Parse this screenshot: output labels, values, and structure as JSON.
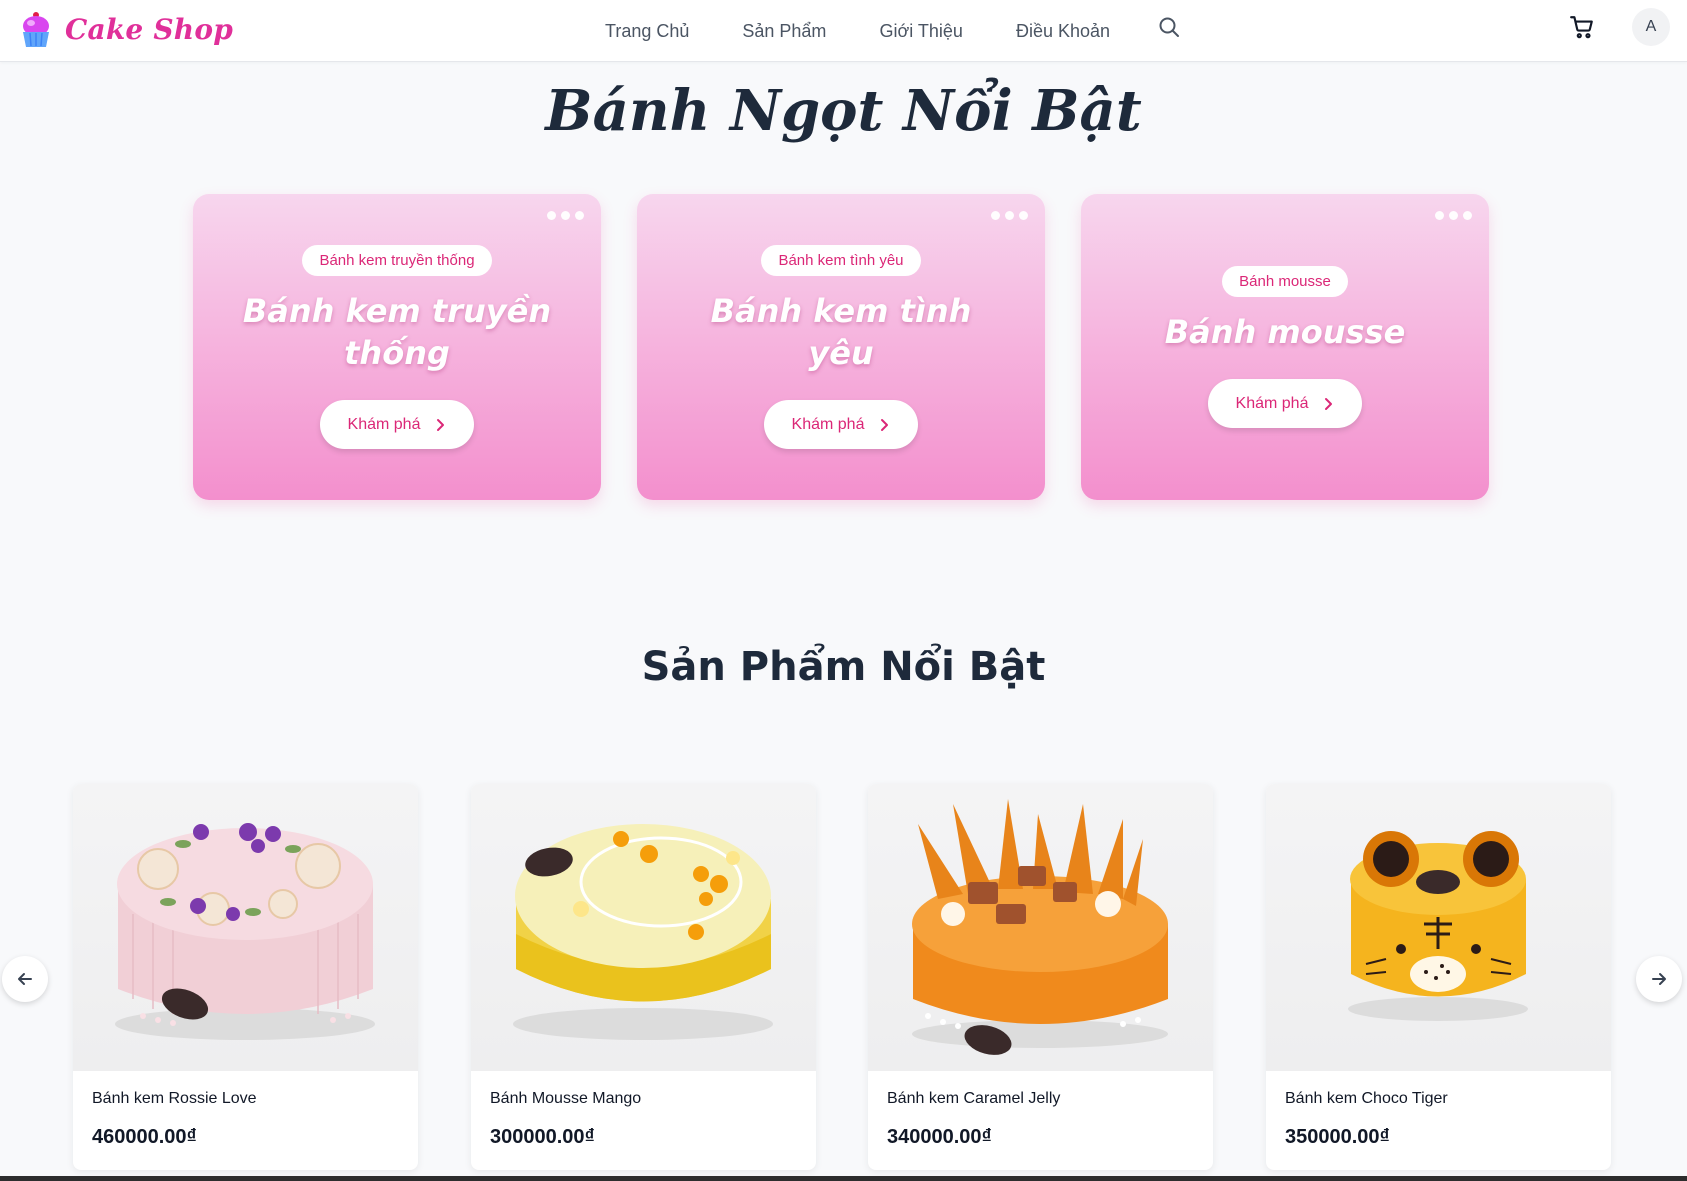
{
  "header": {
    "brand": "Cake Shop",
    "nav": [
      "Trang Chủ",
      "Sản Phẩm",
      "Giới Thiệu",
      "Điều Khoản"
    ],
    "avatar_initial": "A"
  },
  "featured": {
    "title": "Bánh Ngọt Nổi Bật",
    "categories": [
      {
        "badge": "Bánh kem truyền thống",
        "title": "Bánh kem truyền thống",
        "button": "Khám phá"
      },
      {
        "badge": "Bánh kem tình yêu",
        "title": "Bánh kem tình yêu",
        "button": "Khám phá"
      },
      {
        "badge": "Bánh mousse",
        "title": "Bánh mousse",
        "button": "Khám phá"
      }
    ]
  },
  "products": {
    "title": "Sản Phẩm Nổi Bật",
    "items": [
      {
        "name": "Bánh kem Rossie Love",
        "price": "460000.00₫"
      },
      {
        "name": "Bánh Mousse Mango",
        "price": "300000.00₫"
      },
      {
        "name": "Bánh kem Caramel Jelly",
        "price": "340000.00₫"
      },
      {
        "name": "Bánh kem Choco Tiger",
        "price": "350000.00₫"
      }
    ]
  },
  "colors": {
    "brand": "#e0309a",
    "card_top": "#f7d6ee",
    "card_bottom": "#f38fcd",
    "accent_text": "#db2777",
    "heading": "#1e2a3b"
  },
  "icons": [
    "cupcake-icon",
    "search-icon",
    "cart-icon",
    "chevron-right-icon",
    "arrow-left-icon",
    "arrow-right-icon",
    "more-dots-icon"
  ]
}
